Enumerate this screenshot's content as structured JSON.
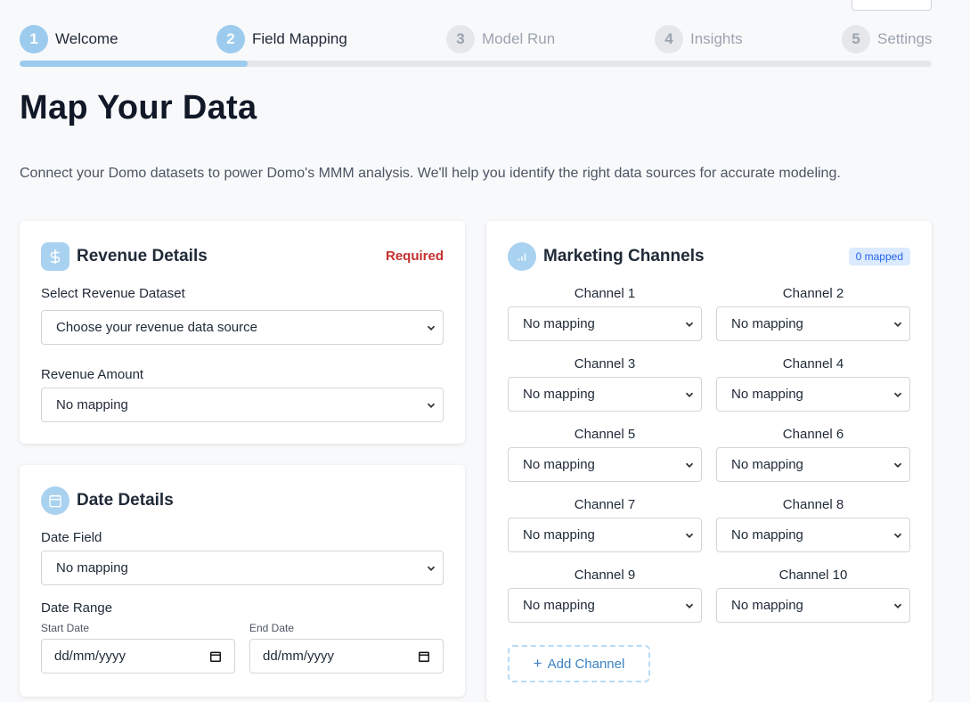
{
  "steps": [
    {
      "num": "1",
      "label": "Welcome",
      "state": "active"
    },
    {
      "num": "2",
      "label": "Field Mapping",
      "state": "active"
    },
    {
      "num": "3",
      "label": "Model Run",
      "state": "inactive"
    },
    {
      "num": "4",
      "label": "Insights",
      "state": "inactive"
    },
    {
      "num": "5",
      "label": "Settings",
      "state": "inactive"
    }
  ],
  "progress_fraction": 0.25,
  "page": {
    "title": "Map Your Data",
    "subtitle": "Connect your Domo datasets to power Domo's MMM analysis. We'll help you identify the right data sources for accurate modeling."
  },
  "revenue": {
    "title": "Revenue Details",
    "icon": "dollar-icon",
    "required": "Required",
    "dataset_label": "Select Revenue Dataset",
    "dataset_value": "Choose your revenue data source",
    "amount_label": "Revenue Amount",
    "amount_value": "No mapping"
  },
  "date": {
    "title": "Date Details",
    "icon": "calendar-icon",
    "field_label": "Date Field",
    "field_value": "No mapping",
    "range_label": "Date Range",
    "start_label": "Start Date",
    "start_placeholder": "dd/mm/yyyy",
    "end_label": "End Date",
    "end_placeholder": "dd/mm/yyyy"
  },
  "marketing": {
    "title": "Marketing Channels",
    "icon": "bar-chart-icon",
    "badge": "0 mapped",
    "channels": [
      {
        "label": "Channel 1",
        "value": "No mapping"
      },
      {
        "label": "Channel 2",
        "value": "No mapping"
      },
      {
        "label": "Channel 3",
        "value": "No mapping"
      },
      {
        "label": "Channel 4",
        "value": "No mapping"
      },
      {
        "label": "Channel 5",
        "value": "No mapping"
      },
      {
        "label": "Channel 6",
        "value": "No mapping"
      },
      {
        "label": "Channel 7",
        "value": "No mapping"
      },
      {
        "label": "Channel 8",
        "value": "No mapping"
      },
      {
        "label": "Channel 9",
        "value": "No mapping"
      },
      {
        "label": "Channel 10",
        "value": "No mapping"
      }
    ],
    "add_label": "Add Channel"
  },
  "colors": {
    "accent": "#9ccbee",
    "required": "#c53030",
    "badge_bg": "#dbeafe",
    "badge_text": "#2563eb"
  }
}
